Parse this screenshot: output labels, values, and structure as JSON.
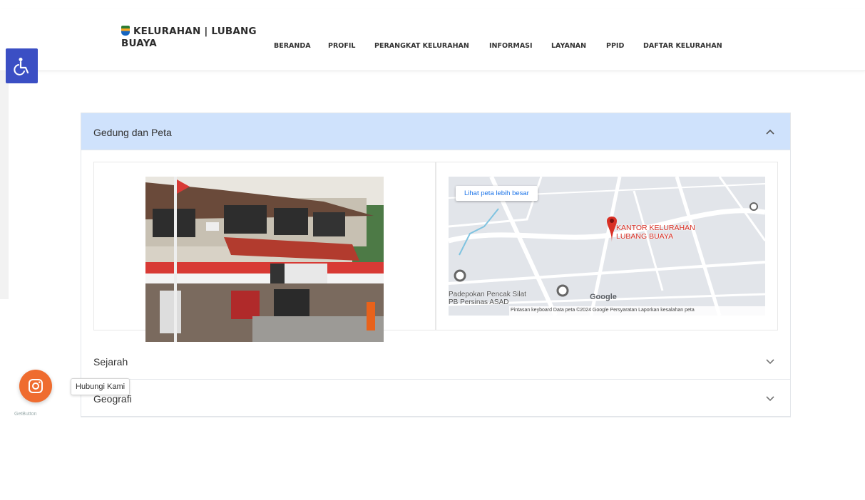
{
  "brand": {
    "line1": "KELURAHAN | LUBANG",
    "line2": "BUAYA"
  },
  "menu": [
    "BERANDA",
    "PROFIL",
    "PERANGKAT KELURAHAN",
    "INFORMASI",
    "LAYANAN",
    "PPID",
    "DAFTAR KELURAHAN"
  ],
  "accordion": {
    "sections": [
      {
        "label": "Gedung dan Peta",
        "expanded": true
      },
      {
        "label": "Sejarah",
        "expanded": false
      },
      {
        "label": "Geografi",
        "expanded": false
      }
    ]
  },
  "map": {
    "larger_map_link": "Lihat peta lebih besar",
    "place_label": "KANTOR KELURAHAN LUBANG BUAYA",
    "nearby_place": "Padepokan Pencak Silat PB Persinas ASAD",
    "google": "Google",
    "footer": "Pintasan keyboard   Data peta ©2024 Google   Persyaratan   Laporkan kesalahan peta"
  },
  "floating_contact": {
    "tooltip": "Hubungi Kami",
    "widget_brand": "GetButton"
  },
  "colors": {
    "accordion_active": "#cfe2fc",
    "accessibility": "#3b4fc4",
    "contact_button": "#ef6c2f",
    "map_pin": "#d93025"
  }
}
